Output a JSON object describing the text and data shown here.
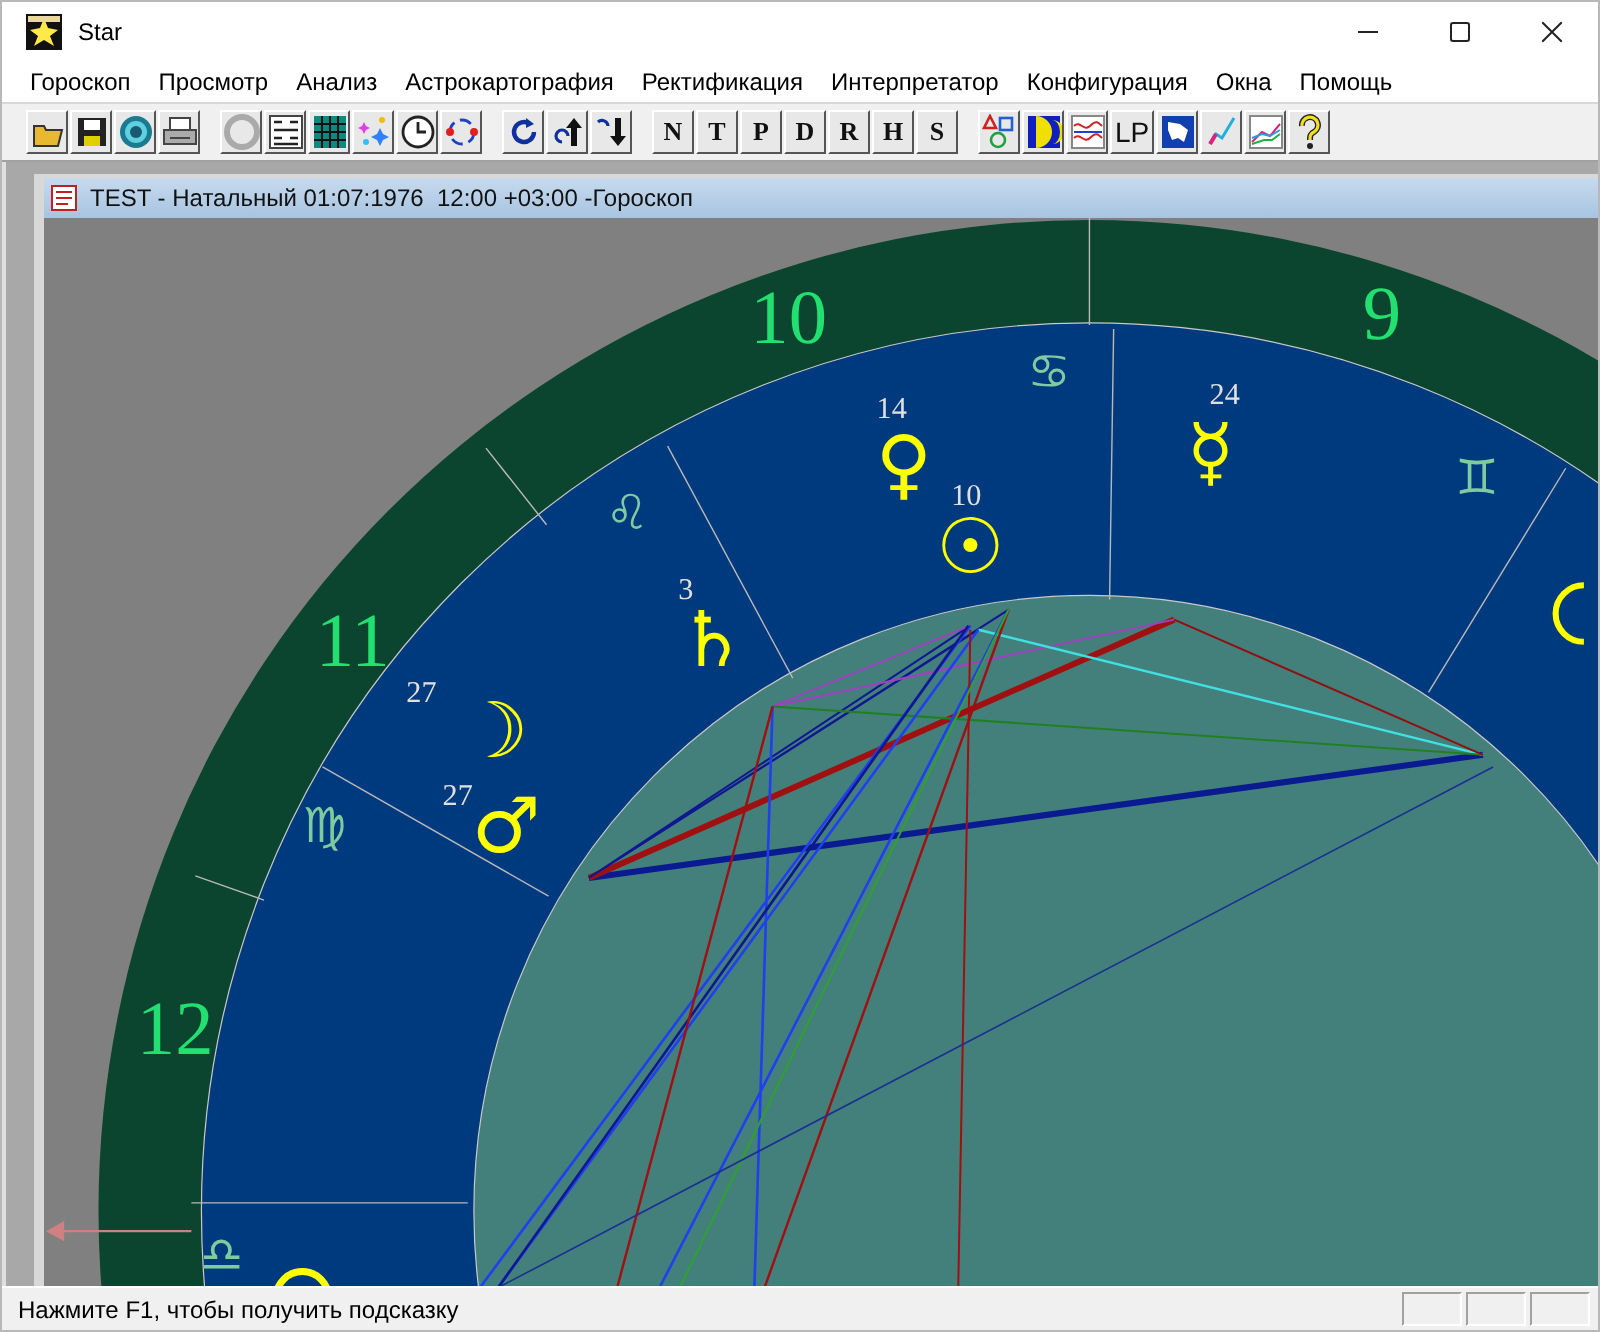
{
  "window": {
    "title": "Star"
  },
  "menu": [
    "Гороскоп",
    "Просмотр",
    "Анализ",
    "Астрокартография",
    "Ректификация",
    "Интерпретатор",
    "Конфигурация",
    "Окна",
    "Помощь"
  ],
  "toolbar": [
    [
      {
        "kind": "open"
      },
      {
        "kind": "save"
      },
      {
        "kind": "target"
      },
      {
        "kind": "print"
      }
    ],
    [
      {
        "kind": "disc"
      },
      {
        "kind": "numbers"
      },
      {
        "kind": "grid"
      },
      {
        "kind": "stars"
      },
      {
        "kind": "clock"
      },
      {
        "kind": "cycle"
      }
    ],
    [
      {
        "kind": "rotate"
      },
      {
        "kind": "up"
      },
      {
        "kind": "down"
      }
    ],
    [
      {
        "kind": "text",
        "label": "N"
      },
      {
        "kind": "text",
        "label": "T"
      },
      {
        "kind": "text",
        "label": "P"
      },
      {
        "kind": "text",
        "label": "D"
      },
      {
        "kind": "text",
        "label": "R"
      },
      {
        "kind": "text",
        "label": "H"
      },
      {
        "kind": "text",
        "label": "S"
      }
    ],
    [
      {
        "kind": "shapes"
      },
      {
        "kind": "moon"
      },
      {
        "kind": "wave"
      },
      {
        "kind": "text",
        "label": "LP"
      },
      {
        "kind": "map"
      },
      {
        "kind": "pen"
      },
      {
        "kind": "graph"
      },
      {
        "kind": "help"
      }
    ]
  ],
  "document": {
    "title": "TEST - Натальный 01:07:1976  12:00 +03:00 -Гороскоп",
    "chart": {
      "houses": [
        {
          "number": "10"
        },
        {
          "number": "9"
        },
        {
          "number": "11"
        },
        {
          "number": "12"
        }
      ],
      "signs": [
        {
          "glyph": "♋"
        },
        {
          "glyph": "♌"
        },
        {
          "glyph": "♍"
        },
        {
          "glyph": "♎"
        },
        {
          "glyph": "♊"
        }
      ],
      "planets": [
        {
          "glyph": "♀",
          "degree": "14"
        },
        {
          "glyph": "☉",
          "degree": "10"
        },
        {
          "glyph": "☿",
          "degree": "24"
        },
        {
          "glyph": "♄",
          "degree": "3"
        },
        {
          "glyph": "☽",
          "degree": "27"
        },
        {
          "glyph": "♂",
          "degree": "27"
        }
      ]
    }
  },
  "status_bar": {
    "text": "Нажмите F1, чтобы получить подсказку"
  }
}
